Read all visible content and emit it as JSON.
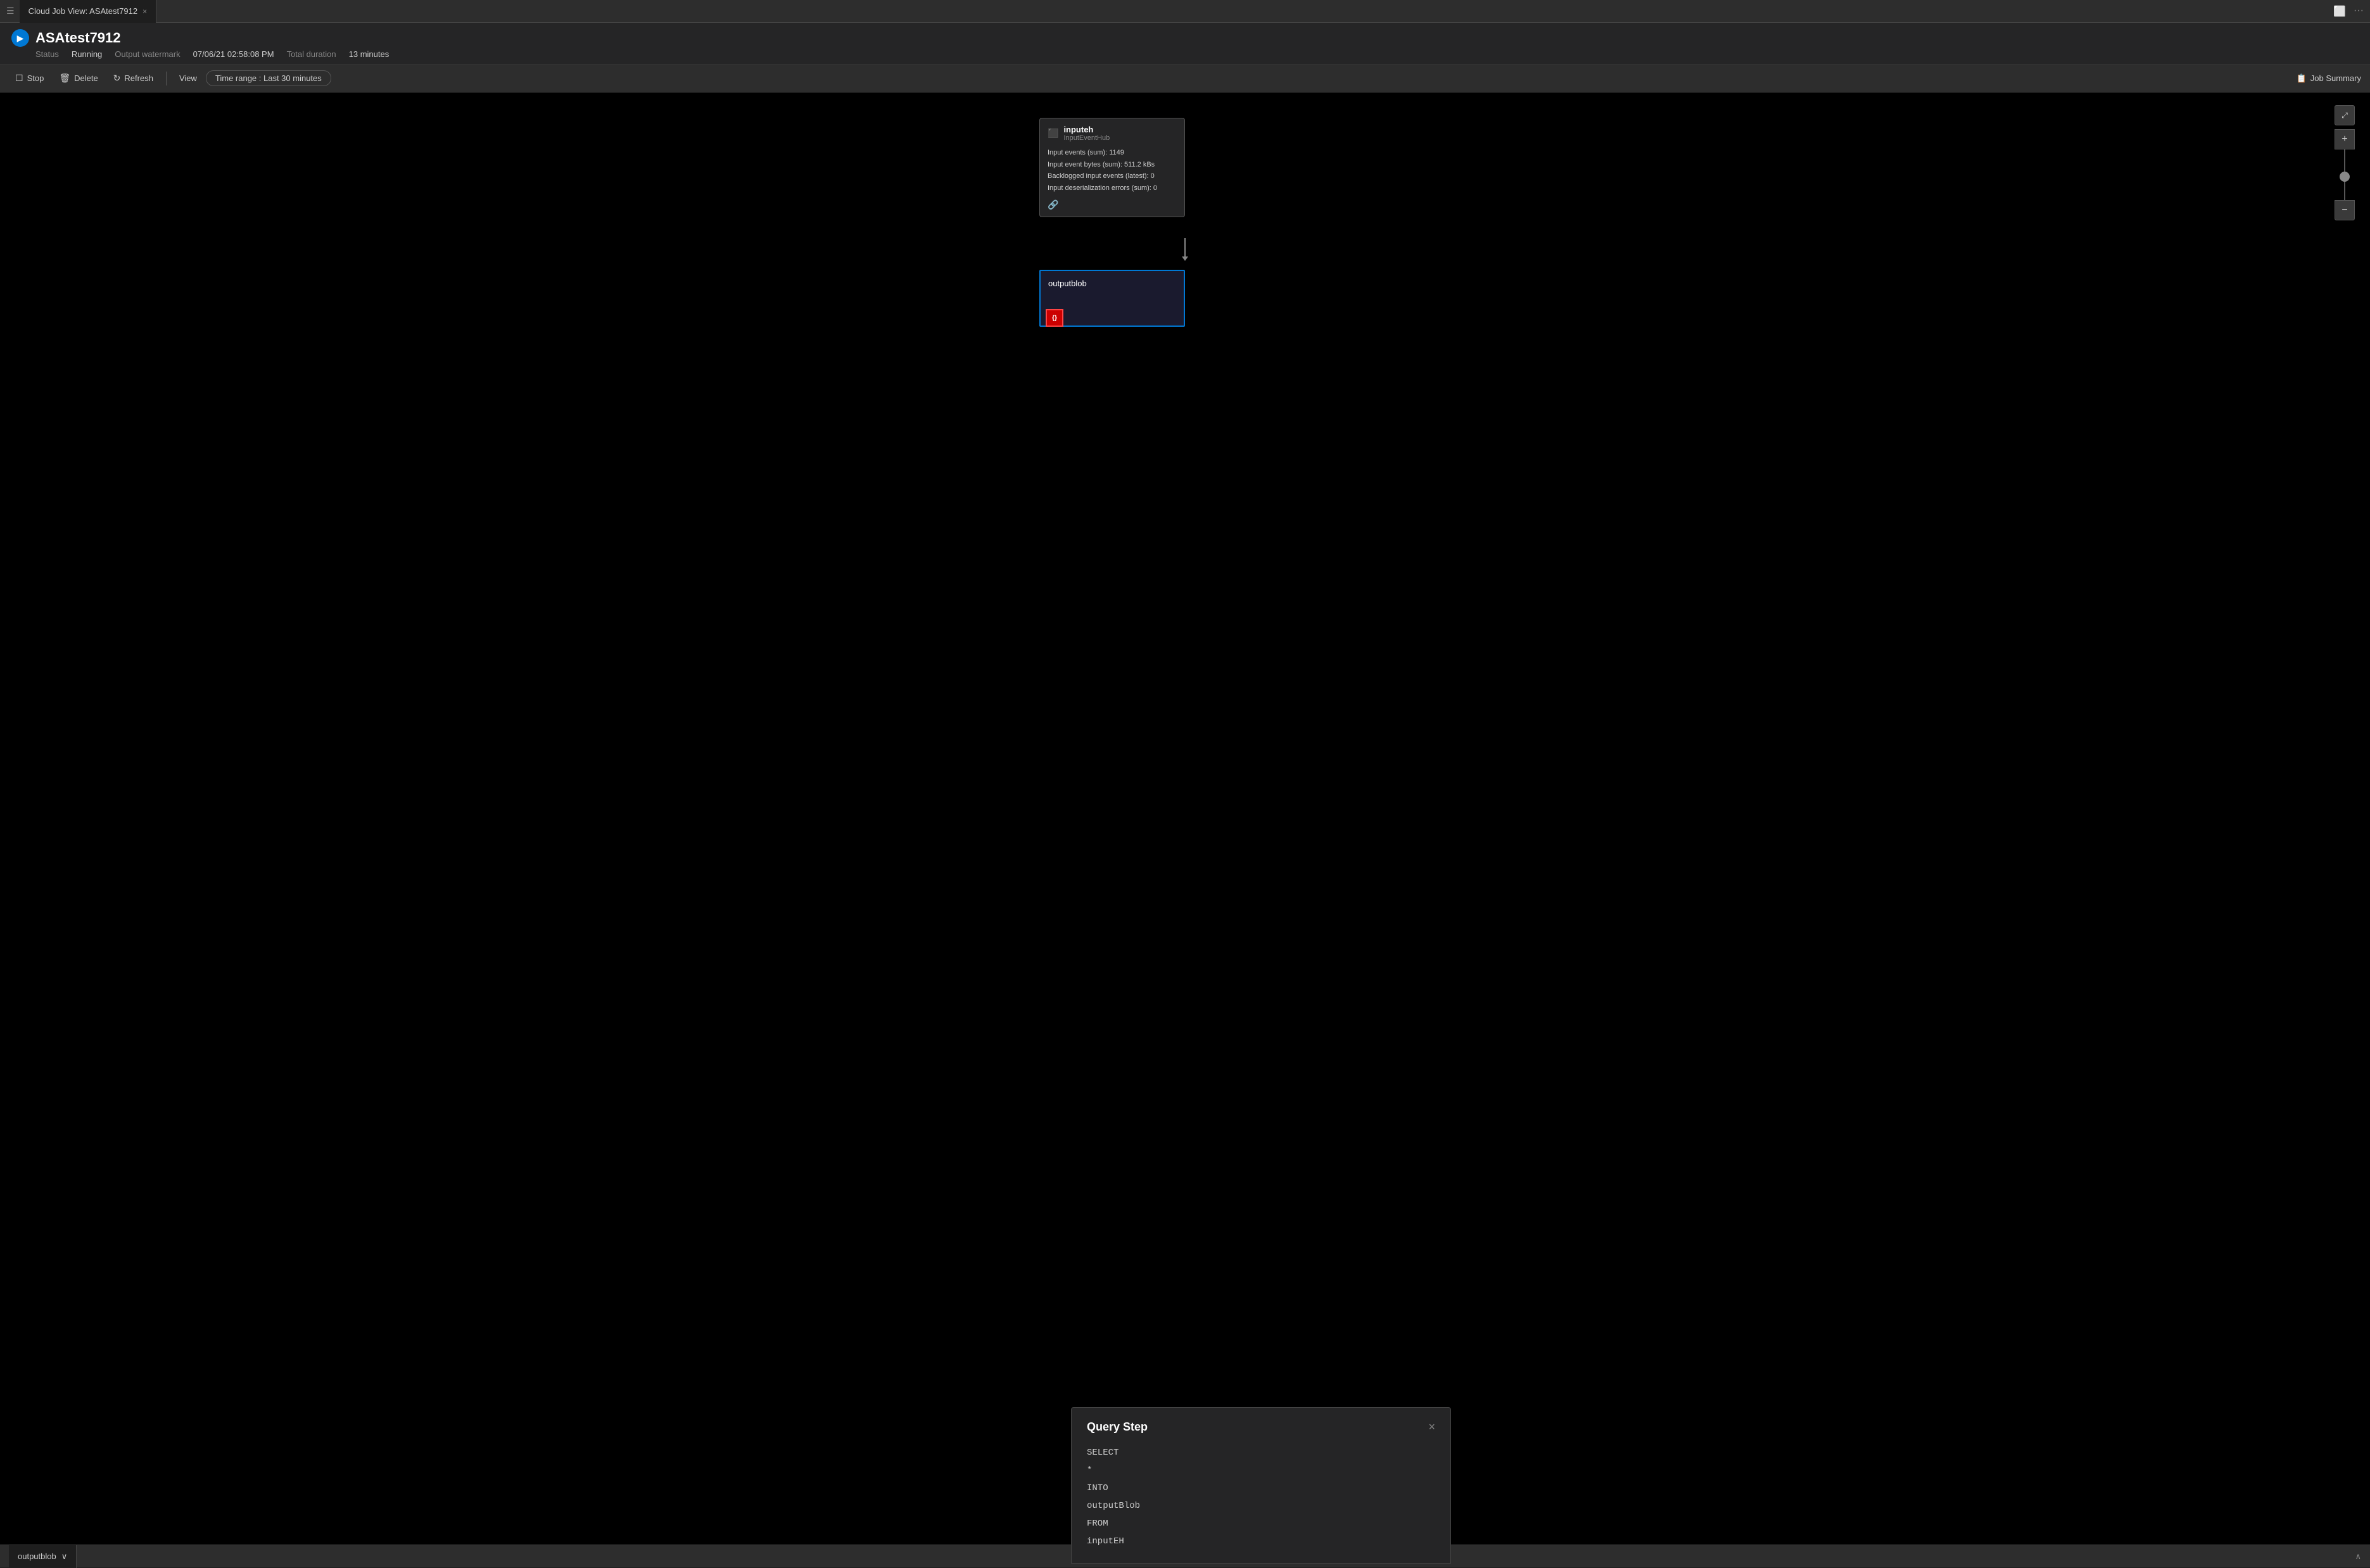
{
  "tab": {
    "icon": "☰",
    "label": "Cloud Job View: ASAtest7912",
    "close_label": "×"
  },
  "window_actions": {
    "layout_icon": "⬜",
    "more_icon": "···"
  },
  "title_bar": {
    "job_name": "ASAtest7912",
    "status_label": "Status",
    "status_value": "Running",
    "watermark_label": "Output watermark",
    "watermark_value": "07/06/21 02:58:08 PM",
    "duration_label": "Total duration",
    "duration_value": "13 minutes"
  },
  "toolbar": {
    "stop_label": "Stop",
    "delete_label": "Delete",
    "refresh_label": "Refresh",
    "view_label": "View",
    "time_range_label": "Time range :  Last 30 minutes",
    "job_summary_label": "Job Summary"
  },
  "zoom": {
    "fit_icon": "⤢",
    "plus_icon": "+",
    "minus_icon": "−"
  },
  "input_node": {
    "name": "inputeh",
    "type": "InputEventHub",
    "stats": [
      "Input events (sum): 1149",
      "Input event bytes (sum): 511.2 kBs",
      "Backlogged input events (latest): 0",
      "Input deserialization errors (sum): 0"
    ],
    "link_icon": "🔗"
  },
  "output_node": {
    "name": "outputblob",
    "icon_label": "{}"
  },
  "query_panel": {
    "title": "Query Step",
    "close_icon": "×",
    "lines": [
      "SELECT",
      "*",
      "INTO",
      "outputBlob",
      "FROM",
      "inputEH"
    ]
  },
  "bottom_tab": {
    "label": "outputblob",
    "chevron": "∨"
  }
}
